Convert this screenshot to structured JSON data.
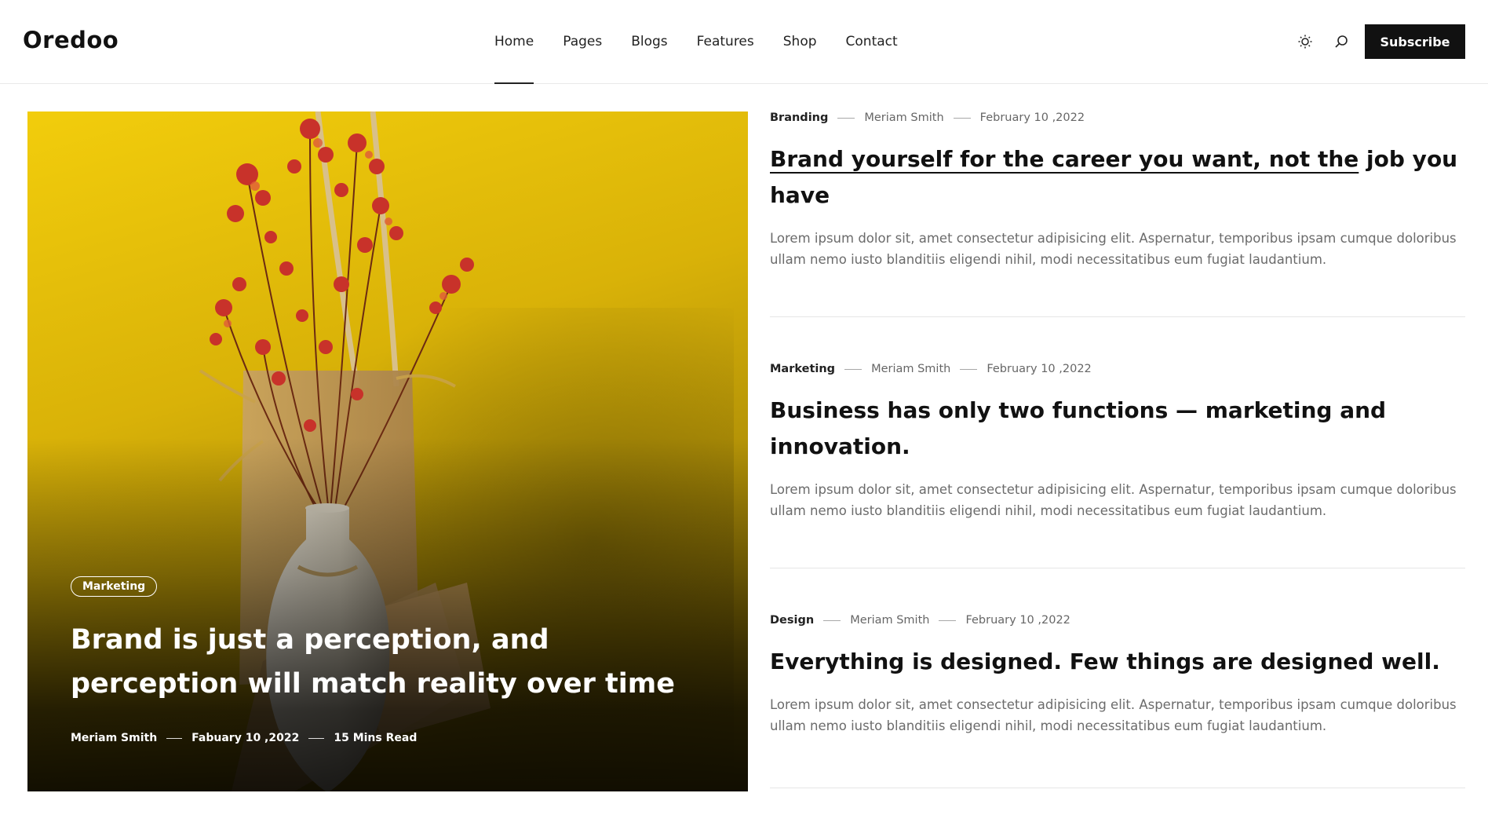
{
  "brand": {
    "logo": "Oredoo"
  },
  "nav": {
    "items": [
      {
        "label": "Home",
        "active": true
      },
      {
        "label": "Pages",
        "active": false
      },
      {
        "label": "Blogs",
        "active": false
      },
      {
        "label": "Features",
        "active": false
      },
      {
        "label": "Shop",
        "active": false
      },
      {
        "label": "Contact",
        "active": false
      }
    ]
  },
  "header": {
    "icons": [
      "sun-icon",
      "search-icon"
    ],
    "subscribe_label": "Subscribe"
  },
  "featured": {
    "category": "Marketing",
    "title": "Brand is just a perception, and perception will match reality over time",
    "author": "Meriam Smith",
    "date": "Fabuary 10 ,2022",
    "read_time": "15 Mins Read"
  },
  "posts": [
    {
      "category": "Branding",
      "author": "Meriam Smith",
      "date": "February 10 ,2022",
      "title_underlined": "Brand yourself for the career you want, not the",
      "title_rest": " job you have",
      "excerpt": "Lorem ipsum dolor sit, amet consectetur adipisicing elit. Aspernatur, temporibus ipsam cumque doloribus ullam nemo iusto blanditiis eligendi nihil, modi necessitatibus eum fugiat laudantium."
    },
    {
      "category": "Marketing",
      "author": "Meriam Smith",
      "date": "February 10 ,2022",
      "title": "Business has only two functions — marketing and innovation.",
      "excerpt": "Lorem ipsum dolor sit, amet consectetur adipisicing elit. Aspernatur, temporibus ipsam cumque doloribus ullam nemo iusto blanditiis eligendi nihil, modi necessitatibus eum fugiat laudantium."
    },
    {
      "category": "Design",
      "author": "Meriam Smith",
      "date": "February 10 ,2022",
      "title": "Everything is designed. Few things are designed well.",
      "excerpt": "Lorem ipsum dolor sit, amet consectetur adipisicing elit. Aspernatur, temporibus ipsam cumque doloribus ullam nemo iusto blanditiis eligendi nihil, modi necessitatibus eum fugiat laudantium."
    }
  ],
  "colors": {
    "accent": "#111111",
    "image_yellow": "#e8c20a",
    "flower_red": "#c8322a"
  }
}
